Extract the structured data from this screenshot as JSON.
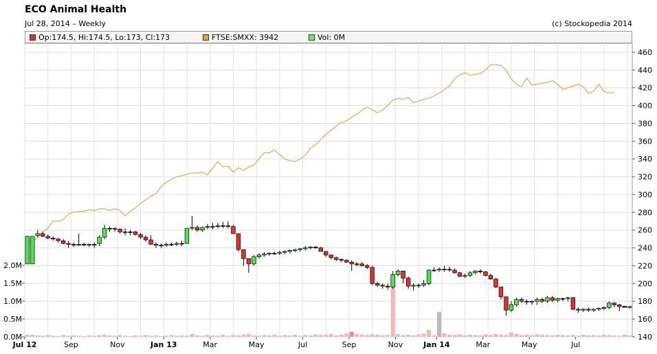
{
  "header": {
    "title": "ECO Animal Health",
    "subtitle": "Jul 28, 2014 – Weekly",
    "copyright": "(c) Stockopedia 2014"
  },
  "legend": [
    {
      "label": "Op:174.5, Hi:174.5, Lo:173, Cl:173",
      "color": "#dd3333"
    },
    {
      "label": "FTSE:SMXX: 3942",
      "color": "#e8a040"
    },
    {
      "label": "Vol: 0M",
      "color": "#66ee66"
    }
  ],
  "chart_data": {
    "type": "candlestick",
    "title": "ECO Animal Health",
    "y_right": {
      "min": 140,
      "max": 470,
      "ticks": [
        140,
        160,
        180,
        200,
        220,
        240,
        260,
        280,
        300,
        320,
        340,
        360,
        380,
        400,
        420,
        440,
        460
      ]
    },
    "y_left_volume": {
      "min": 0,
      "max": 2.5,
      "ticks": [
        {
          "v": 0,
          "label": "0.0M"
        },
        {
          "v": 0.5,
          "label": "0.5M"
        },
        {
          "v": 1.0,
          "label": "1.0M"
        },
        {
          "v": 1.5,
          "label": "1.5M"
        },
        {
          "v": 2.0,
          "label": "2.0M"
        }
      ]
    },
    "x_labels": [
      {
        "label": "Jul 12",
        "week": 0,
        "bold": true
      },
      {
        "label": "Sep",
        "week": 9,
        "bold": false
      },
      {
        "label": "Nov",
        "week": 18,
        "bold": false
      },
      {
        "label": "Jan 13",
        "week": 27,
        "bold": true
      },
      {
        "label": "Mar",
        "week": 36,
        "bold": false
      },
      {
        "label": "May",
        "week": 45,
        "bold": false
      },
      {
        "label": "Jul",
        "week": 54,
        "bold": false
      },
      {
        "label": "Sep",
        "week": 63,
        "bold": false
      },
      {
        "label": "Nov",
        "week": 72,
        "bold": false
      },
      {
        "label": "Jan 14",
        "week": 80,
        "bold": true
      },
      {
        "label": "Mar",
        "week": 89,
        "bold": false
      },
      {
        "label": "May",
        "week": 98,
        "bold": false
      },
      {
        "label": "Jul",
        "week": 107,
        "bold": false
      }
    ],
    "candles": [
      [
        222,
        253,
        222,
        253
      ],
      [
        222,
        253,
        222,
        253
      ],
      [
        254,
        260,
        252,
        256
      ],
      [
        256,
        258,
        252,
        253
      ],
      [
        253,
        255,
        250,
        251
      ],
      [
        251,
        253,
        248,
        250
      ],
      [
        250,
        251,
        246,
        248
      ],
      [
        248,
        250,
        244,
        245
      ],
      [
        245,
        248,
        240,
        244
      ],
      [
        244,
        246,
        241,
        243
      ],
      [
        243,
        256,
        242,
        244
      ],
      [
        244,
        246,
        242,
        243
      ],
      [
        243,
        245,
        241,
        244
      ],
      [
        244,
        246,
        240,
        243
      ],
      [
        245,
        254,
        242,
        252
      ],
      [
        252,
        266,
        250,
        262
      ],
      [
        262,
        264,
        258,
        262
      ],
      [
        262,
        263,
        258,
        261
      ],
      [
        261,
        262,
        256,
        258
      ],
      [
        258,
        262,
        254,
        258
      ],
      [
        258,
        260,
        254,
        258
      ],
      [
        258,
        259,
        254,
        255
      ],
      [
        255,
        257,
        250,
        252
      ],
      [
        252,
        254,
        247,
        249
      ],
      [
        249,
        254,
        244,
        244
      ],
      [
        244,
        246,
        240,
        243
      ],
      [
        243,
        245,
        240,
        243
      ],
      [
        243,
        246,
        241,
        244
      ],
      [
        244,
        246,
        242,
        244
      ],
      [
        244,
        247,
        242,
        245
      ],
      [
        245,
        248,
        242,
        245
      ],
      [
        245,
        262,
        245,
        262
      ],
      [
        262,
        276,
        260,
        263
      ],
      [
        263,
        265,
        258,
        260
      ],
      [
        260,
        264,
        258,
        263
      ],
      [
        263,
        267,
        261,
        264
      ],
      [
        264,
        268,
        261,
        264
      ],
      [
        264,
        268,
        262,
        265
      ],
      [
        265,
        269,
        262,
        265
      ],
      [
        265,
        270,
        262,
        264
      ],
      [
        264,
        266,
        256,
        256
      ],
      [
        256,
        256,
        236,
        238
      ],
      [
        238,
        238,
        220,
        228
      ],
      [
        228,
        228,
        212,
        222
      ],
      [
        222,
        232,
        220,
        230
      ],
      [
        230,
        234,
        228,
        232
      ],
      [
        232,
        235,
        230,
        233
      ],
      [
        233,
        235,
        231,
        234
      ],
      [
        234,
        236,
        232,
        234
      ],
      [
        234,
        237,
        232,
        235
      ],
      [
        235,
        237,
        233,
        236
      ],
      [
        236,
        238,
        234,
        237
      ],
      [
        237,
        239,
        235,
        238
      ],
      [
        238,
        240,
        236,
        239
      ],
      [
        239,
        242,
        237,
        240
      ],
      [
        240,
        242,
        238,
        241
      ],
      [
        241,
        242,
        239,
        240
      ],
      [
        240,
        241,
        236,
        236
      ],
      [
        236,
        236,
        230,
        232
      ],
      [
        232,
        232,
        227,
        229
      ],
      [
        229,
        230,
        225,
        227
      ],
      [
        227,
        228,
        224,
        226
      ],
      [
        226,
        227,
        223,
        224
      ],
      [
        224,
        226,
        214,
        222
      ],
      [
        222,
        224,
        219,
        222
      ],
      [
        222,
        224,
        219,
        220
      ],
      [
        220,
        222,
        216,
        218
      ],
      [
        218,
        220,
        198,
        200
      ],
      [
        200,
        202,
        196,
        198
      ],
      [
        198,
        200,
        194,
        197
      ],
      [
        197,
        200,
        193,
        196
      ],
      [
        196,
        214,
        194,
        210
      ],
      [
        210,
        216,
        208,
        214
      ],
      [
        214,
        214,
        200,
        206
      ],
      [
        206,
        208,
        194,
        197
      ],
      [
        197,
        200,
        192,
        198
      ],
      [
        198,
        200,
        195,
        198
      ],
      [
        198,
        204,
        196,
        200
      ],
      [
        200,
        216,
        198,
        215
      ],
      [
        215,
        218,
        213,
        215
      ],
      [
        215,
        218,
        213,
        216
      ],
      [
        216,
        220,
        213,
        216
      ],
      [
        216,
        219,
        213,
        215
      ],
      [
        215,
        217,
        211,
        212
      ],
      [
        212,
        213,
        207,
        208
      ],
      [
        208,
        211,
        206,
        209
      ],
      [
        209,
        214,
        207,
        212
      ],
      [
        212,
        215,
        210,
        214
      ],
      [
        214,
        216,
        211,
        213
      ],
      [
        213,
        214,
        208,
        209
      ],
      [
        209,
        211,
        204,
        205
      ],
      [
        205,
        206,
        195,
        196
      ],
      [
        196,
        196,
        182,
        185
      ],
      [
        185,
        185,
        164,
        170
      ],
      [
        170,
        180,
        168,
        176
      ],
      [
        176,
        184,
        174,
        182
      ],
      [
        182,
        184,
        178,
        180
      ],
      [
        180,
        182,
        176,
        179
      ],
      [
        179,
        181,
        176,
        180
      ],
      [
        180,
        184,
        176,
        182
      ],
      [
        182,
        184,
        178,
        180
      ],
      [
        180,
        186,
        178,
        184
      ],
      [
        184,
        186,
        179,
        181
      ],
      [
        181,
        184,
        179,
        183
      ],
      [
        183,
        184,
        180,
        183
      ],
      [
        183,
        185,
        180,
        184
      ],
      [
        184,
        185,
        170,
        171
      ],
      [
        171,
        173,
        167,
        170
      ],
      [
        170,
        172,
        168,
        171
      ],
      [
        171,
        173,
        168,
        170
      ],
      [
        170,
        172,
        168,
        171
      ],
      [
        171,
        173,
        169,
        172
      ],
      [
        172,
        174,
        170,
        173
      ],
      [
        173,
        180,
        171,
        178
      ],
      [
        178,
        179,
        173,
        176
      ],
      [
        176,
        177,
        169,
        174
      ],
      [
        174.5,
        174.5,
        173,
        173
      ],
      [
        173,
        175,
        172,
        174
      ]
    ],
    "ftse": [
      245,
      247,
      252,
      258,
      262,
      270,
      270,
      272,
      278,
      280,
      281,
      281,
      283,
      282,
      284,
      284,
      282,
      284,
      282,
      276,
      281,
      285,
      290,
      294,
      298,
      301,
      309,
      314,
      317,
      320,
      321,
      323,
      324,
      324,
      325,
      322,
      330,
      337,
      331,
      332,
      325,
      330,
      327,
      331,
      333,
      340,
      347,
      347,
      350,
      345,
      340,
      338,
      337,
      340,
      344,
      352,
      356,
      362,
      368,
      372,
      377,
      381,
      383,
      387,
      390,
      395,
      398,
      395,
      392,
      395,
      400,
      406,
      408,
      407,
      409,
      403,
      405,
      407,
      408,
      411,
      414,
      418,
      422,
      430,
      435,
      437,
      434,
      435,
      436,
      440,
      446,
      446,
      445,
      440,
      430,
      424,
      421,
      431,
      423,
      424,
      425,
      426,
      428,
      424,
      418,
      420,
      422,
      424,
      421,
      414,
      416,
      424,
      416,
      414,
      415
    ],
    "volume": [
      0.06,
      0.06,
      0.04,
      0.03,
      0.05,
      0.03,
      0.02,
      0.05,
      0.03,
      0.04,
      0.03,
      0.02,
      0.04,
      0.03,
      0.05,
      0.06,
      0.04,
      0.03,
      0.05,
      0.03,
      0.02,
      0.04,
      0.03,
      0.05,
      0.03,
      0.04,
      0.02,
      0.03,
      0.05,
      0.03,
      0.04,
      0.03,
      0.08,
      0.04,
      0.03,
      0.05,
      0.04,
      0.03,
      0.06,
      0.03,
      0.05,
      0.04,
      0.06,
      0.08,
      0.04,
      0.03,
      0.05,
      0.04,
      0.06,
      0.03,
      0.05,
      0.04,
      0.06,
      0.03,
      0.05,
      0.04,
      0.07,
      0.05,
      0.06,
      0.08,
      0.04,
      0.06,
      0.09,
      0.14,
      0.08,
      0.06,
      0.05,
      0.07,
      0.06,
      0.04,
      0.05,
      1.7,
      0.08,
      0.05,
      0.06,
      0.04,
      0.07,
      0.09,
      0.2,
      0.05,
      0.7,
      0.1,
      0.06,
      0.05,
      0.07,
      0.04,
      0.06,
      0.05,
      0.04,
      0.07,
      0.05,
      0.08,
      0.06,
      0.05,
      0.12,
      0.09,
      0.05,
      0.06,
      0.05,
      0.07,
      0.06,
      0.05,
      0.04,
      0.06,
      0.05,
      0.04,
      0.05,
      0.03,
      0.06,
      0.04,
      0.05,
      0.04,
      0.06,
      0.05,
      0.04,
      0.03,
      0.06,
      0.04
    ],
    "volume_special": {
      "72": "#99ee99",
      "80": "#bbbbbb",
      "63": "#ee8888"
    }
  }
}
